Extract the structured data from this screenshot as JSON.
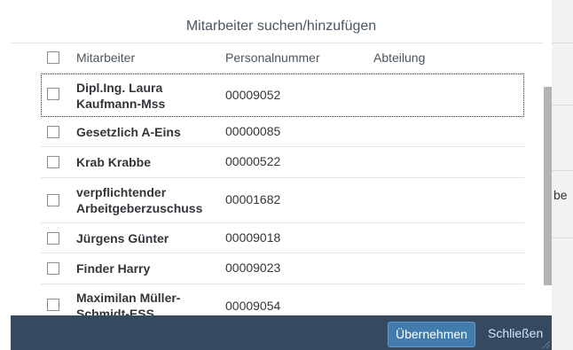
{
  "dialog": {
    "title": "Mitarbeiter suchen/hinzufügen",
    "columns": {
      "name": "Mitarbeiter",
      "number": "Personalnummer",
      "dept": "Abteilung"
    },
    "rows": [
      {
        "name": "Dipl.Ing. Laura Kaufmann-Mss",
        "number": "00009052",
        "dept": ""
      },
      {
        "name": "Gesetzlich A-Eins",
        "number": "00000085",
        "dept": ""
      },
      {
        "name": "Krab Krabbe",
        "number": "00000522",
        "dept": ""
      },
      {
        "name": "verpflichtender Arbeitgeberzuschuss",
        "number": "00001682",
        "dept": ""
      },
      {
        "name": "Jürgens Günter",
        "number": "00009018",
        "dept": ""
      },
      {
        "name": "Finder Harry",
        "number": "00009023",
        "dept": ""
      },
      {
        "name": "Maximilan Müller-Schmidt-ESS",
        "number": "00009054",
        "dept": ""
      }
    ],
    "buttons": {
      "apply": "Übernehmen",
      "close": "Schließen"
    }
  },
  "background": {
    "partial_text": "be"
  }
}
